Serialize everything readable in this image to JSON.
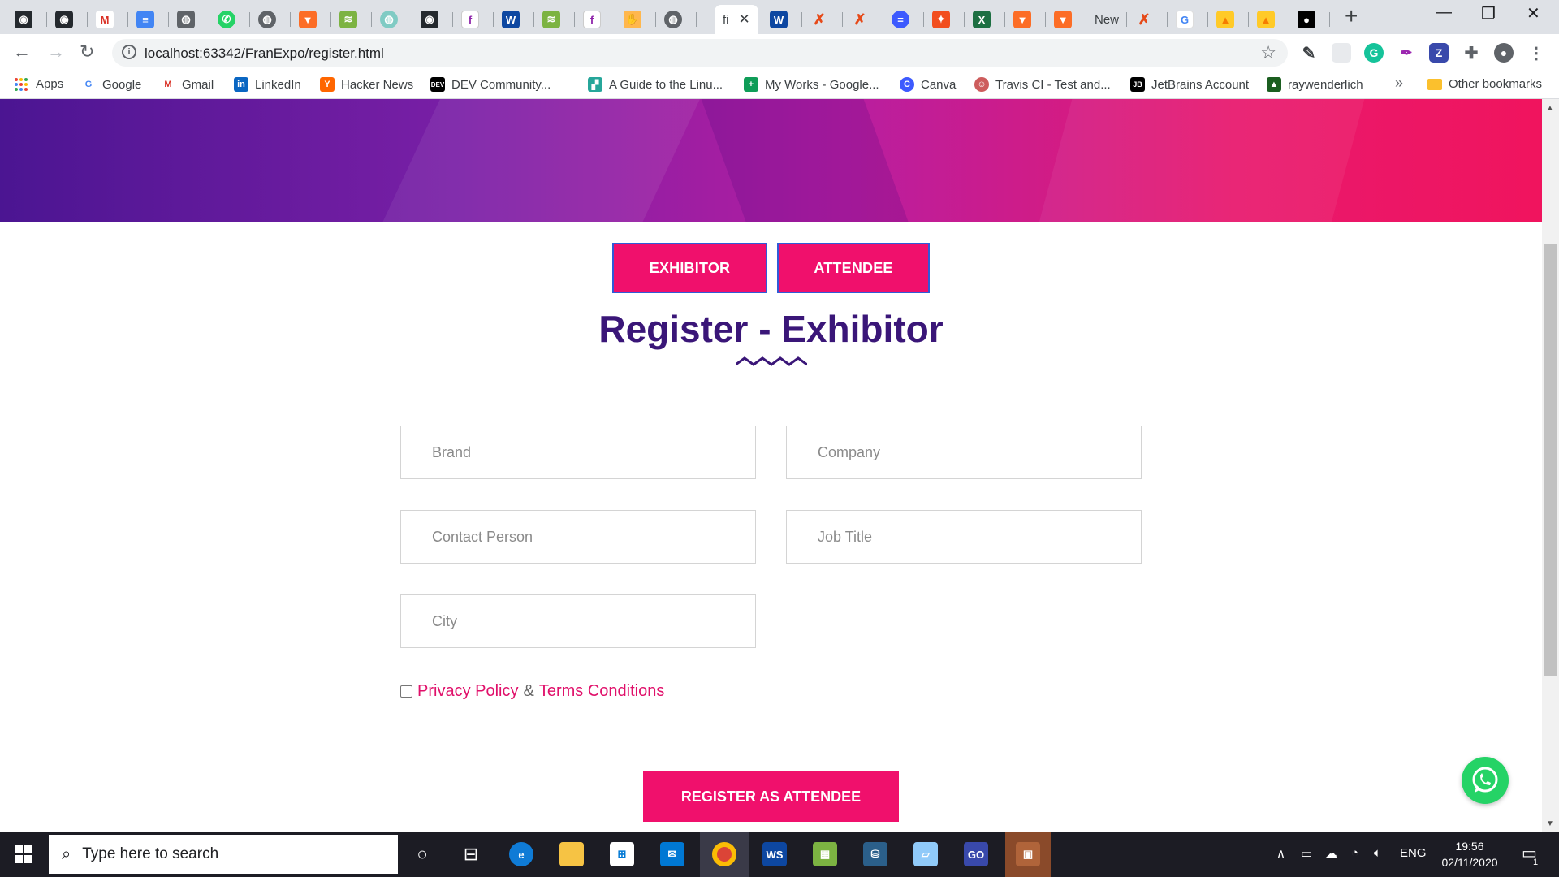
{
  "browser": {
    "tabs": [
      {
        "icon": "github-icon",
        "label": ""
      },
      {
        "icon": "github-icon",
        "label": ""
      },
      {
        "icon": "gmail-icon",
        "label": ""
      },
      {
        "icon": "docs-icon",
        "label": ""
      },
      {
        "icon": "globe-icon",
        "label": ""
      },
      {
        "icon": "whatsapp-icon",
        "label": ""
      },
      {
        "icon": "globe-icon",
        "label": ""
      },
      {
        "icon": "gitlab-icon",
        "label": ""
      },
      {
        "icon": "code-icon",
        "label": ""
      },
      {
        "icon": "globe-icon",
        "label": ""
      },
      {
        "icon": "github-icon",
        "label": ""
      },
      {
        "icon": "f-icon",
        "label": ""
      },
      {
        "icon": "webstorm-icon",
        "label": ""
      },
      {
        "icon": "code-icon",
        "label": ""
      },
      {
        "icon": "f-icon",
        "label": ""
      },
      {
        "icon": "hand-icon",
        "label": ""
      },
      {
        "icon": "globe-icon",
        "label": ""
      },
      {
        "icon": "f-icon",
        "label": "fi",
        "active": true
      },
      {
        "icon": "webstorm-icon",
        "label": ""
      },
      {
        "icon": "x-icon",
        "label": ""
      },
      {
        "icon": "x-icon",
        "label": ""
      },
      {
        "icon": "chat-icon",
        "label": ""
      },
      {
        "icon": "figma-icon",
        "label": ""
      },
      {
        "icon": "excel-icon",
        "label": ""
      },
      {
        "icon": "gitlab-icon",
        "label": ""
      },
      {
        "icon": "gitlab-icon",
        "label": ""
      },
      {
        "icon": "",
        "label": "New"
      },
      {
        "icon": "x-icon",
        "label": ""
      },
      {
        "icon": "google-icon",
        "label": ""
      },
      {
        "icon": "firebase-icon",
        "label": ""
      },
      {
        "icon": "firebase-icon",
        "label": ""
      },
      {
        "icon": "medium-icon",
        "label": ""
      }
    ],
    "url": "localhost:63342/FranExpo/register.html",
    "bookmarks": [
      {
        "icon": "apps-icon",
        "label": "Apps"
      },
      {
        "icon": "google-icon",
        "label": "Google"
      },
      {
        "icon": "gmail-icon",
        "label": "Gmail"
      },
      {
        "icon": "linkedin-icon",
        "label": "LinkedIn"
      },
      {
        "icon": "hackernews-icon",
        "label": "Hacker News"
      },
      {
        "icon": "dev-icon",
        "label": "DEV Community..."
      },
      {
        "icon": "guide-icon",
        "label": "A Guide to the Linu..."
      },
      {
        "icon": "plus-icon",
        "label": "My Works - Google..."
      },
      {
        "icon": "canva-icon",
        "label": "Canva"
      },
      {
        "icon": "travis-icon",
        "label": "Travis CI - Test and..."
      },
      {
        "icon": "jetbrains-icon",
        "label": "JetBrains Account"
      },
      {
        "icon": "rw-icon",
        "label": "raywenderlich"
      }
    ],
    "bookmarks_more": "»",
    "other_bookmarks": "Other bookmarks"
  },
  "page": {
    "tab_exhibitor": "EXHIBITOR",
    "tab_attendee": "ATTENDEE",
    "title": "Register - Exhibitor",
    "fields": {
      "brand": "Brand",
      "company": "Company",
      "contact_person": "Contact Person",
      "job_title": "Job Title",
      "city": "City"
    },
    "consent": {
      "privacy": "Privacy Policy",
      "amp": "&",
      "terms": "Terms Conditions"
    },
    "submit": "REGISTER AS ATTENDEE"
  },
  "taskbar": {
    "search_placeholder": "Type here to search",
    "language": "ENG",
    "time": "19:56",
    "date": "02/11/2020",
    "notifications": "1"
  },
  "colors": {
    "accent_pink": "#f0106c",
    "title_purple": "#3a1678",
    "link_pink": "#e0106a"
  }
}
